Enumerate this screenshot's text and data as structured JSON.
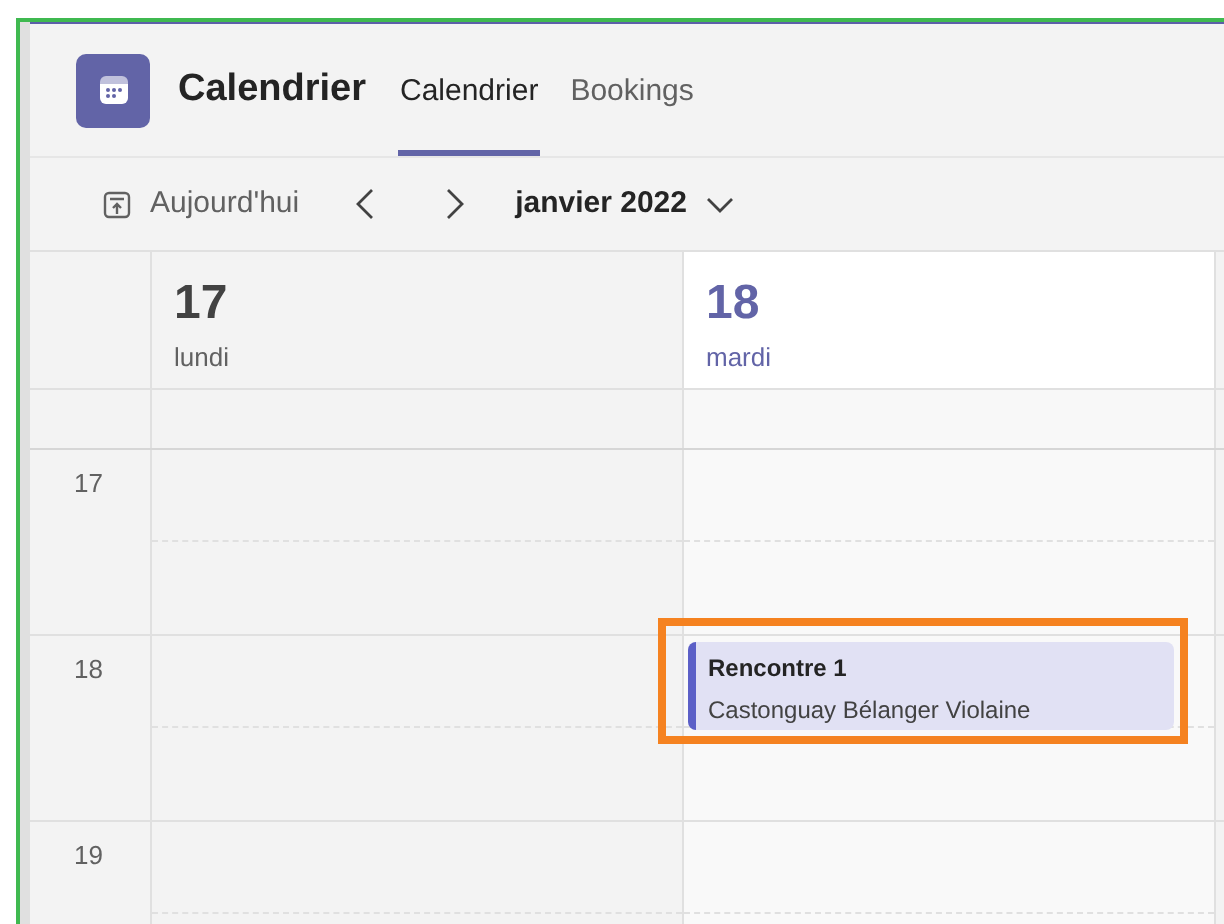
{
  "app": {
    "title": "Calendrier"
  },
  "tabs": [
    {
      "label": "Calendrier",
      "selected": true
    },
    {
      "label": "Bookings",
      "selected": false
    }
  ],
  "toolbar": {
    "today": "Aujourd'hui",
    "month": "janvier 2022"
  },
  "days": [
    {
      "number": "17",
      "name": "lundi",
      "selected": false
    },
    {
      "number": "18",
      "name": "mardi",
      "selected": true,
      "events": [
        {
          "title": "Rencontre 1",
          "organizer": "Castonguay Bélanger Violaine",
          "highlighted": true
        }
      ]
    }
  ],
  "hours": [
    "17",
    "18",
    "19"
  ]
}
